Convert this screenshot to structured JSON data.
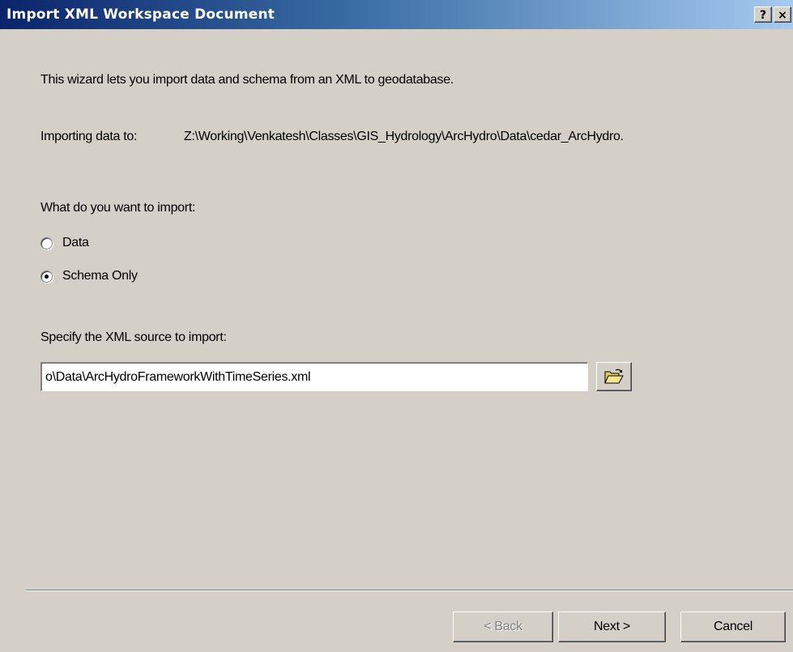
{
  "window": {
    "title": "Import XML Workspace Document",
    "help_button": "?",
    "close_button": "×"
  },
  "intro_text": "This wizard lets you import data and schema from an XML to geodatabase.",
  "importing": {
    "label": "Importing data to:",
    "path": "Z:\\Working\\Venkatesh\\Classes\\GIS_Hydrology\\ArcHydro\\Data\\cedar_ArcHydro."
  },
  "import_options": {
    "question": "What do you want to import:",
    "options": [
      {
        "label": "Data",
        "selected": false
      },
      {
        "label": "Schema Only",
        "selected": true
      }
    ]
  },
  "source": {
    "label": "Specify the XML source to import:",
    "value": "o\\Data\\ArcHydroFrameworkWithTimeSeries.xml",
    "browse_icon": "open-folder-icon"
  },
  "buttons": {
    "back": "< Back",
    "next": "Next >",
    "cancel": "Cancel"
  },
  "colors": {
    "titlebar_start": "#0a246a",
    "titlebar_end": "#a6caf0",
    "dialog_bg": "#d4d0c8"
  }
}
